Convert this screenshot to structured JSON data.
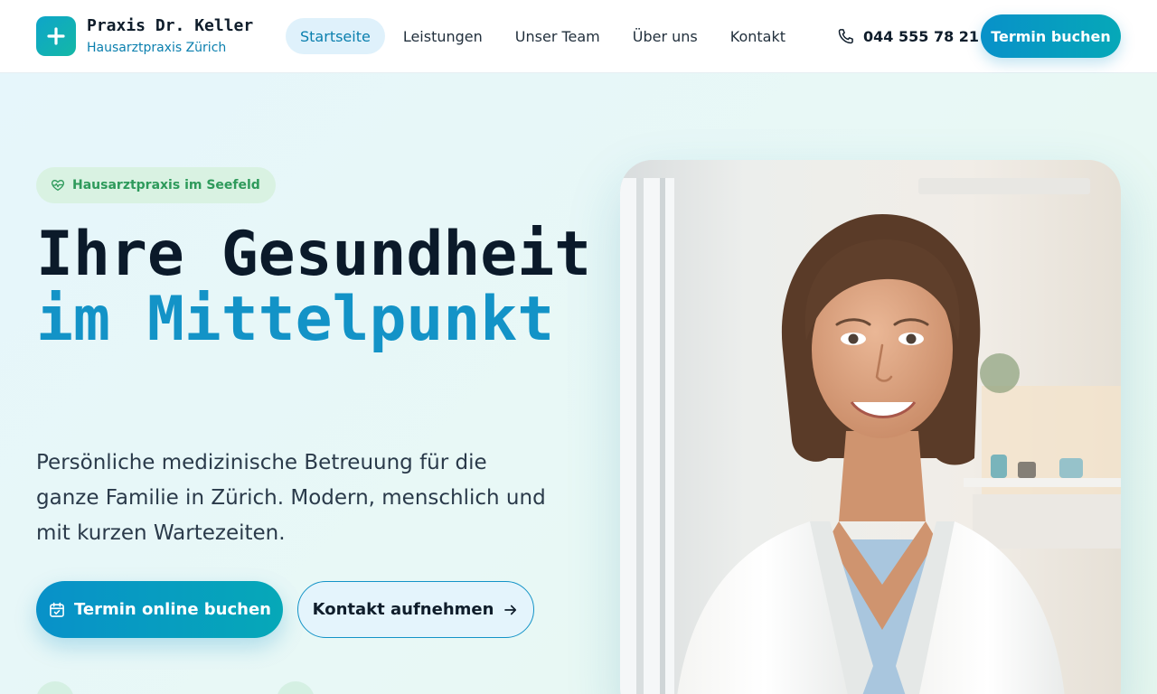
{
  "brand": {
    "name": "Praxis Dr. Keller",
    "subtitle": "Hausarztpraxis Zürich",
    "logo_icon": "plus-icon",
    "accent_color": "#0891c9",
    "teal_color": "#14b8a6"
  },
  "nav": {
    "items": [
      {
        "label": "Startseite",
        "active": true
      },
      {
        "label": "Leistungen",
        "active": false
      },
      {
        "label": "Unser Team",
        "active": false
      },
      {
        "label": "Über uns",
        "active": false
      },
      {
        "label": "Kontakt",
        "active": false
      }
    ]
  },
  "header": {
    "phone": "044 555 78 21",
    "phone_icon": "phone-icon",
    "cta_label": "Termin buchen"
  },
  "hero": {
    "badge": "Hausarztpraxis im Seefeld",
    "badge_icon": "heart-pulse-icon",
    "headline_part1": "Ihre Gesundheit",
    "headline_part2": "im Mittelpunkt",
    "lead": "Persönliche medizinische Betreuung für die ganze Familie in Zürich. Modern, menschlich und mit kurzen Wartezeiten.",
    "primary_button": "Termin online buchen",
    "primary_icon": "calendar-check-icon",
    "secondary_button": "Kontakt aufnehmen",
    "secondary_icon": "arrow-right-icon"
  },
  "photo": {
    "subject": "doctor-portrait"
  }
}
